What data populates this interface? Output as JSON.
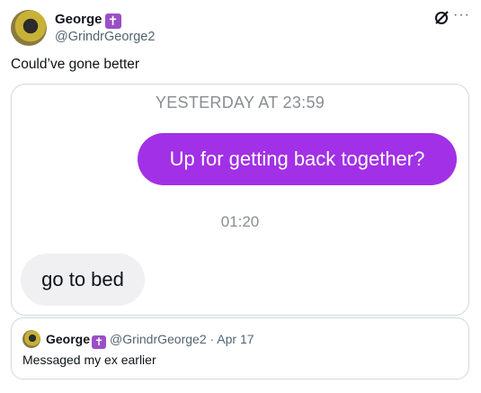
{
  "author": {
    "name": "George",
    "badge": "✝",
    "handle": "@GrindrGeorge2"
  },
  "icons": [
    "grok-icon",
    "more-icon"
  ],
  "more_glyph": "···",
  "tweet": {
    "text": "Could’ve gone better"
  },
  "chat": {
    "timestamp_top": "YESTERDAY AT 23:59",
    "outgoing": "Up for getting back together?",
    "timestamp_mid": "01:20",
    "incoming": "go to bed",
    "colors": {
      "outgoing_bubble": "#a230e6",
      "incoming_bubble": "#f0f0f2"
    }
  },
  "quote": {
    "name": "George",
    "badge": "✝",
    "handle": "@GrindrGeorge2",
    "separator": " · ",
    "date": "Apr 17",
    "text": "Messaged my ex earlier"
  }
}
